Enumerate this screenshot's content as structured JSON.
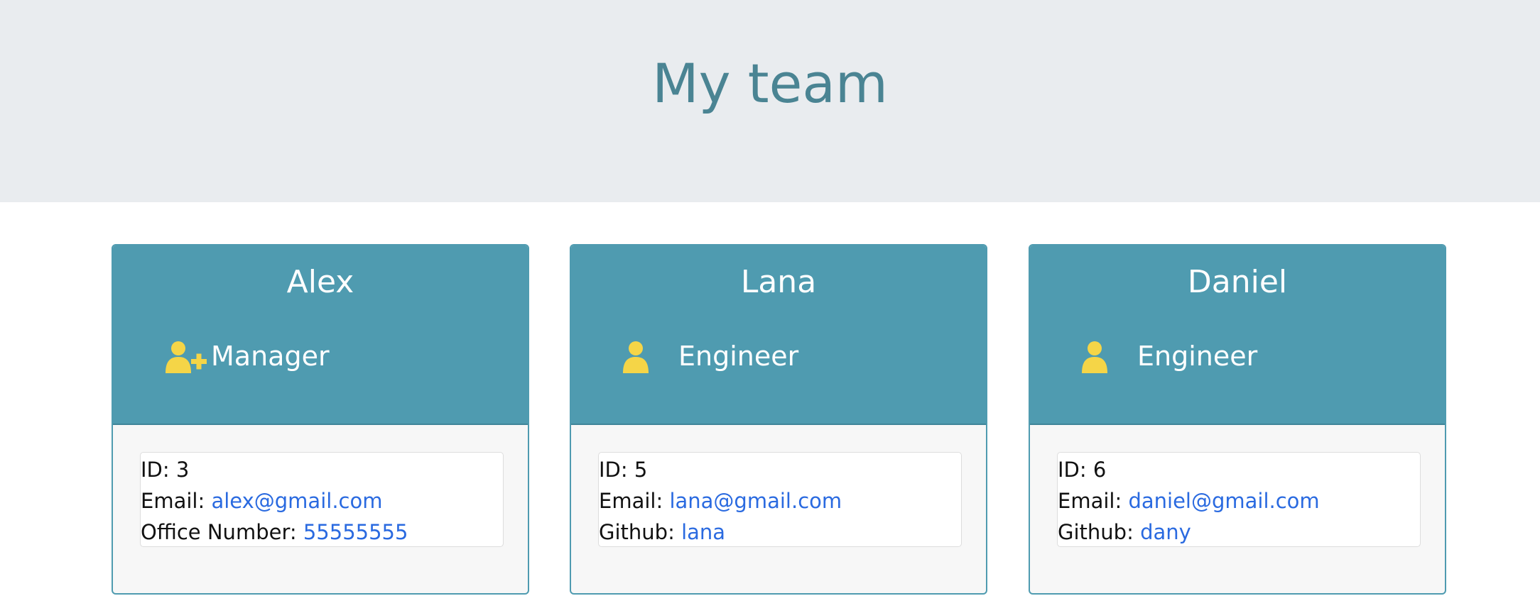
{
  "header": {
    "title": "My team"
  },
  "team": [
    {
      "name": "Alex",
      "role": "Manager",
      "icon": "user-plus-icon",
      "id_label": "ID:",
      "id": "3",
      "email_label": "Email:",
      "email": "alex@gmail.com",
      "extra_label": "Office Number:",
      "extra": "55555555"
    },
    {
      "name": "Lana",
      "role": "Engineer",
      "icon": "user-icon",
      "id_label": "ID:",
      "id": "5",
      "email_label": "Email:",
      "email": "lana@gmail.com",
      "extra_label": "Github:",
      "extra": "lana"
    },
    {
      "name": "Daniel",
      "role": "Engineer",
      "icon": "user-icon",
      "id_label": "ID:",
      "id": "6",
      "email_label": "Email:",
      "email": "daniel@gmail.com",
      "extra_label": "Github:",
      "extra": "dany"
    }
  ],
  "colors": {
    "header_bg": "#e9ecef",
    "title": "#4a8493",
    "card_header": "#4f9bb0",
    "icon": "#f5d547",
    "link": "#2a6ae0"
  }
}
